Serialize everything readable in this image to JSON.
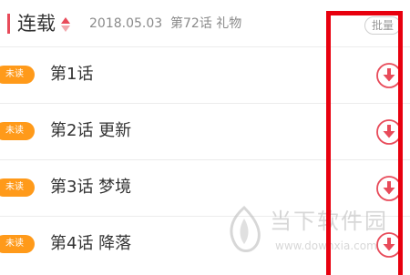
{
  "header": {
    "title": "连载",
    "date": "2018.05.03",
    "latest_chapter": "第72话 礼物",
    "batch_label": "批量"
  },
  "chapters": [
    {
      "badge": "未读",
      "title": "第1话"
    },
    {
      "badge": "未读",
      "title": "第2话 更新"
    },
    {
      "badge": "未读",
      "title": "第3话 梦境"
    },
    {
      "badge": "未读",
      "title": "第4话 降落"
    }
  ],
  "icons": {
    "sort": "sort-icon",
    "download": "download-icon"
  },
  "watermark": {
    "name": "当下软件园",
    "url": "www.downxia.com"
  },
  "colors": {
    "accent": "#e84b5a",
    "badge": "#ff9a1a",
    "highlight": "#e8000e"
  }
}
